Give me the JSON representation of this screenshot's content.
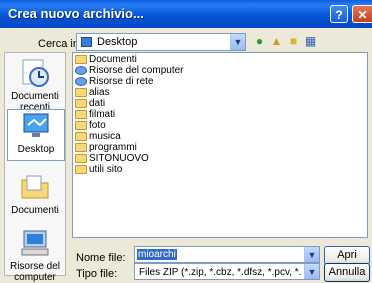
{
  "window": {
    "title": "Crea nuovo archivio...",
    "help_label": "?",
    "close_label": "✕"
  },
  "lookin": {
    "label": "Cerca in:",
    "value": "Desktop"
  },
  "toolbar": {
    "icons": [
      "back-icon",
      "up-folder-icon",
      "new-folder-icon",
      "view-menu-icon"
    ]
  },
  "places": [
    {
      "label": "Documenti recenti",
      "icon": "recent-documents-icon"
    },
    {
      "label": "Desktop",
      "icon": "desktop-icon",
      "selected": true
    },
    {
      "label": "Documenti",
      "icon": "my-documents-icon"
    },
    {
      "label": "Risorse del computer",
      "icon": "my-computer-icon"
    }
  ],
  "files": [
    {
      "name": "Documenti",
      "icon": "documents-folder-icon"
    },
    {
      "name": "Risorse del computer",
      "icon": "my-computer-icon"
    },
    {
      "name": "Risorse di rete",
      "icon": "network-places-icon"
    },
    {
      "name": "alias",
      "icon": "folder-icon"
    },
    {
      "name": "dati",
      "icon": "folder-icon"
    },
    {
      "name": "filmati",
      "icon": "folder-icon"
    },
    {
      "name": "foto",
      "icon": "folder-icon"
    },
    {
      "name": "musica",
      "icon": "folder-icon"
    },
    {
      "name": "programmi",
      "icon": "folder-icon"
    },
    {
      "name": "SITONUOVO",
      "icon": "folder-icon"
    },
    {
      "name": "utili sito",
      "icon": "folder-icon"
    }
  ],
  "filename": {
    "label": "Nome file:",
    "value": "mioarchi"
  },
  "filetype": {
    "label": "Tipo file:",
    "value": "Files ZIP (*.zip, *.cbz, *.dfsz, *.pcv, *.bez, *.mskin)"
  },
  "buttons": {
    "open": "Apri",
    "cancel": "Annulla"
  },
  "colors": {
    "titlebar": "#0555d8",
    "dialog_bg": "#ece9d8",
    "selection": "#316ac5"
  }
}
